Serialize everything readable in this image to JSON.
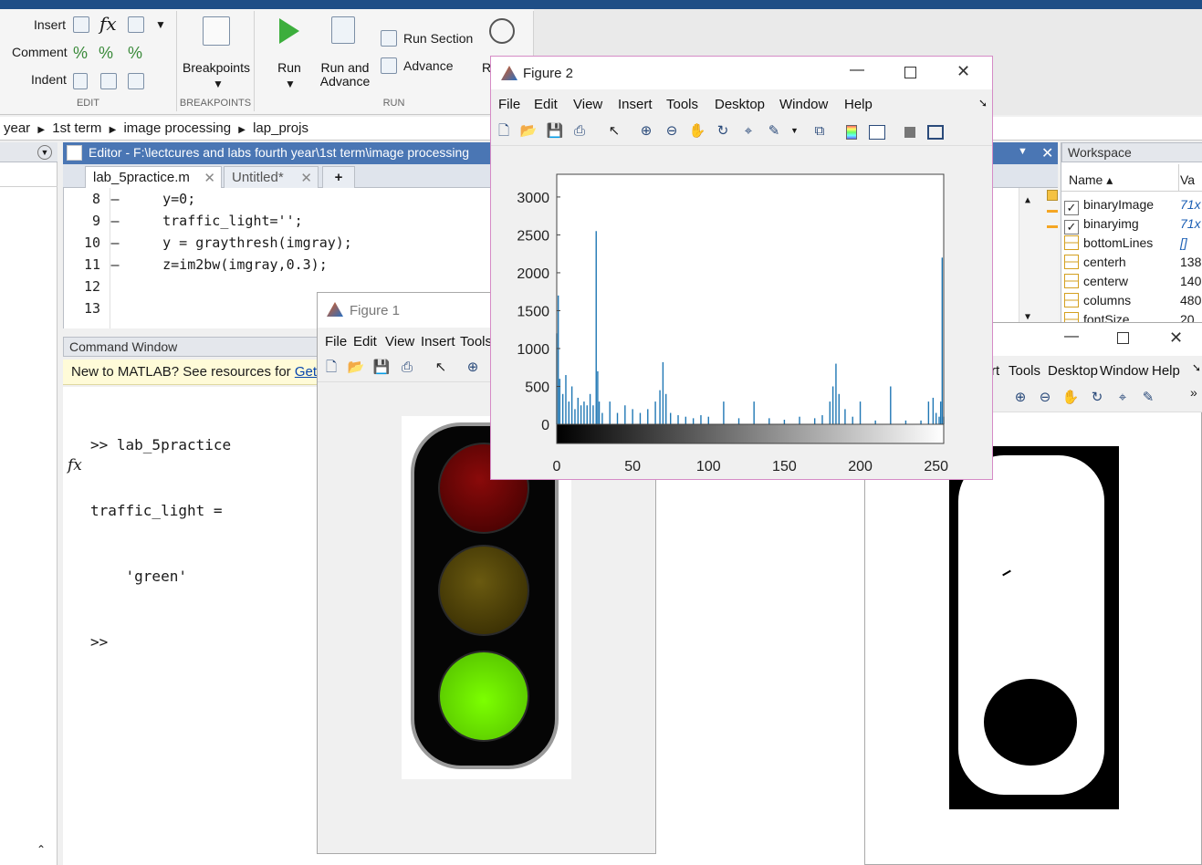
{
  "toolstrip": {
    "edit_group": {
      "insert": "Insert",
      "comment": "Comment",
      "indent": "Indent",
      "label": "EDIT"
    },
    "breakpoints_group": {
      "button": "Breakpoints",
      "label": "BREAKPOINTS"
    },
    "run_group": {
      "run": "Run",
      "run_and_advance_line1": "Run and",
      "run_and_advance_line2": "Advance",
      "run_section": "Run Section",
      "advance": "Advance",
      "run_and_time_partial": "R",
      "label": "RUN"
    }
  },
  "address": [
    "year",
    "1st term",
    "image processing",
    "lap_projs"
  ],
  "editor": {
    "title": "Editor - F:\\lectcures and labs fourth year\\1st term\\image processing",
    "tabs": [
      {
        "label": "lab_5practice.m"
      },
      {
        "label": "Untitled*"
      }
    ],
    "lines": [
      {
        "num": "8",
        "marker": "—",
        "code": "    y=0;"
      },
      {
        "num": "9",
        "marker": "—",
        "code": "    traffic_light='';"
      },
      {
        "num": "10",
        "marker": "—",
        "code": "    y = graythresh(imgray);"
      },
      {
        "num": "11",
        "marker": "—",
        "code": "    z=im2bw(imgray,0.3);"
      },
      {
        "num": "12",
        "marker": "",
        "code": ""
      },
      {
        "num": "13",
        "marker": "",
        "code": ""
      }
    ]
  },
  "command_window": {
    "title": "Command Window",
    "banner_text": "New to MATLAB? See resources for ",
    "banner_link": "Getti",
    "lines": [
      ">> lab_5practice",
      "traffic_light =",
      "    'green'"
    ],
    "prompt": ">>",
    "fx": "fx"
  },
  "workspace": {
    "title": "Workspace",
    "col_name": "Name ▴",
    "col_value": "Va",
    "rows": [
      {
        "name": "binaryImage",
        "value": "71x",
        "icon": "logical-icon"
      },
      {
        "name": "binaryimg",
        "value": "71x",
        "icon": "logical-icon"
      },
      {
        "name": "bottomLines",
        "value": "[]",
        "icon": "array-icon"
      },
      {
        "name": "centerh",
        "value": "138",
        "icon": "array-icon"
      },
      {
        "name": "centerw",
        "value": "140",
        "icon": "array-icon"
      },
      {
        "name": "columns",
        "value": "480",
        "icon": "array-icon"
      },
      {
        "name": "fontSize",
        "value": "20",
        "icon": "array-icon"
      }
    ]
  },
  "figure1": {
    "title": "Figure 1",
    "menu": [
      "File",
      "Edit",
      "View",
      "Insert",
      "Tools"
    ]
  },
  "figure3": {
    "menu": [
      "rt",
      "Tools",
      "Desktop",
      "Window",
      "Help"
    ]
  },
  "figure2": {
    "title": "Figure 2",
    "menu": [
      "File",
      "Edit",
      "View",
      "Insert",
      "Tools",
      "Desktop",
      "Window",
      "Help"
    ]
  },
  "colors": {
    "histogram": "#1f77b4",
    "editor_title": "#4a76b4",
    "green_light": "#7cff00"
  },
  "chart_data": {
    "type": "bar",
    "title": "",
    "xlabel": "",
    "ylabel": "",
    "xlim": [
      0,
      255
    ],
    "ylim": [
      0,
      3300
    ],
    "xticks": [
      0,
      50,
      100,
      150,
      200,
      250
    ],
    "yticks": [
      0,
      500,
      1000,
      1500,
      2000,
      2500,
      3000
    ],
    "colorbar": "grayscale 0-255",
    "x": [
      0,
      1,
      2,
      4,
      6,
      8,
      10,
      12,
      14,
      16,
      18,
      20,
      22,
      24,
      26,
      27,
      28,
      30,
      35,
      40,
      45,
      50,
      55,
      60,
      65,
      68,
      70,
      72,
      75,
      80,
      85,
      90,
      95,
      100,
      110,
      120,
      130,
      140,
      150,
      160,
      170,
      175,
      180,
      182,
      184,
      186,
      190,
      195,
      200,
      210,
      220,
      230,
      240,
      245,
      248,
      250,
      252,
      253,
      254,
      255
    ],
    "y": [
      1200,
      1700,
      600,
      400,
      650,
      300,
      500,
      200,
      350,
      250,
      300,
      250,
      400,
      250,
      2550,
      700,
      300,
      150,
      300,
      150,
      250,
      200,
      150,
      200,
      300,
      450,
      820,
      400,
      150,
      120,
      100,
      80,
      120,
      100,
      300,
      80,
      300,
      80,
      60,
      100,
      80,
      120,
      300,
      500,
      800,
      400,
      200,
      100,
      300,
      50,
      500,
      50,
      50,
      300,
      350,
      150,
      100,
      300,
      2200,
      100
    ]
  }
}
